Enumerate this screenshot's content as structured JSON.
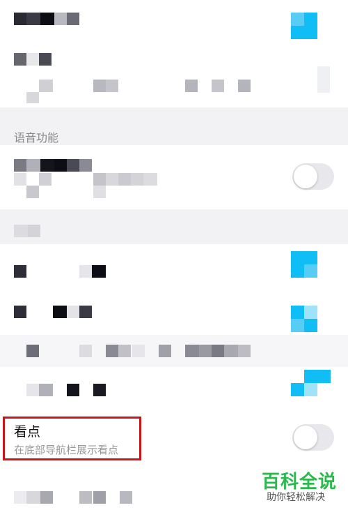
{
  "voice_section": {
    "title": "语音功能"
  },
  "kandian_setting": {
    "title": "看点",
    "subtitle": "在底部导航栏展示看点",
    "toggle_on": false
  },
  "voice_setting": {
    "toggle_on": false
  },
  "watermark": {
    "name": "百科全说",
    "slogan": "助你轻松解决"
  },
  "colors": {
    "icon_blue": "#10bdf5",
    "highlight_red": "#c8161a",
    "watermark_green": "#2db84d",
    "section_background": "#f2f2f4"
  }
}
